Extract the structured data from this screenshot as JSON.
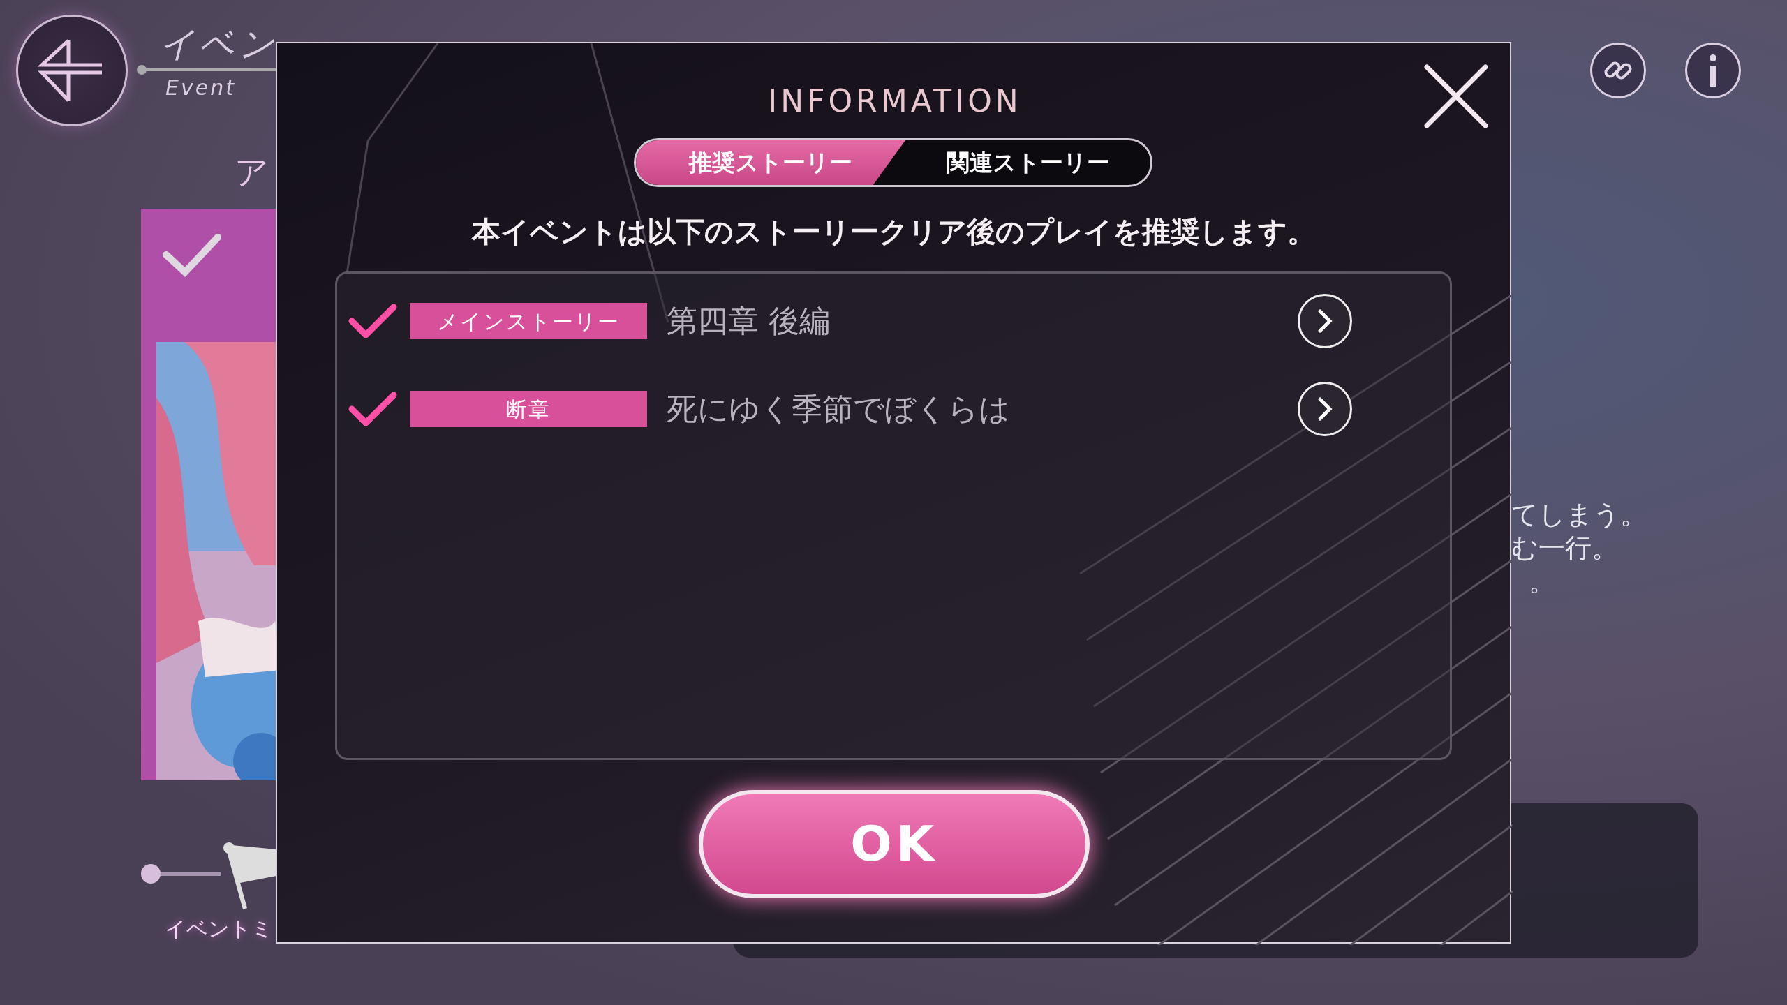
{
  "header": {
    "title": "イベン",
    "subtitle": "Event"
  },
  "partial_heading": "ア",
  "card": {
    "selected": true,
    "kind": "picture"
  },
  "mission_label": "イベントミ",
  "side_text": [
    "てしまう。",
    "む一行。",
    "。"
  ],
  "dialog": {
    "title": "INFORMATION",
    "tabs": [
      {
        "label": "推奨ストーリー",
        "selected": true
      },
      {
        "label": "関連ストーリー",
        "selected": false
      }
    ],
    "message": "本イベントは以下のストーリークリア後のプレイを推奨します。",
    "stories": [
      {
        "category": "メインストーリー",
        "title": "第四章 後編",
        "cleared": true
      },
      {
        "category": "断章",
        "title": "死にゆく季節でぼくらは",
        "cleared": true
      }
    ],
    "ok_button": "OK"
  }
}
